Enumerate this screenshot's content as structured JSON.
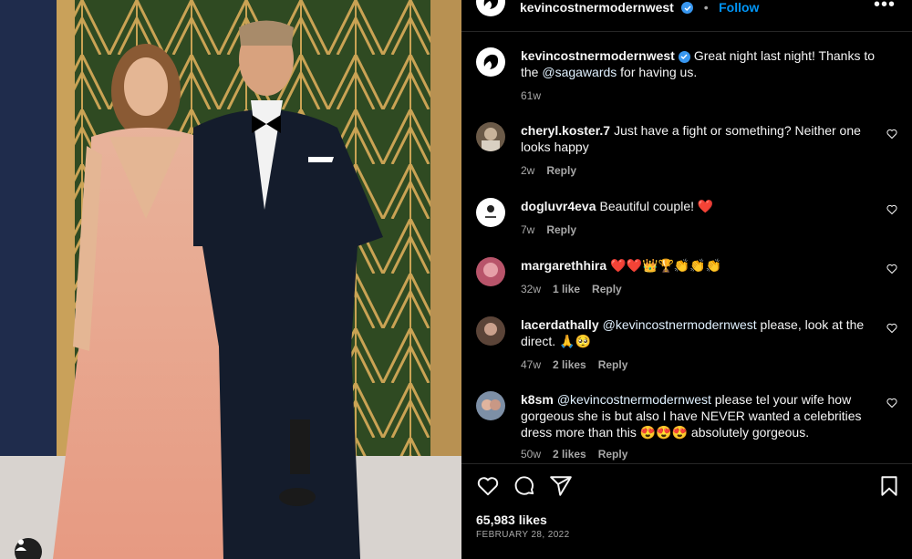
{
  "header": {
    "username": "kevincostnermodernwest",
    "separator": "•",
    "follow_label": "Follow",
    "more_label": "•••"
  },
  "caption": {
    "username": "kevincostnermodernwest",
    "text_before": "Great night last night! Thanks to the ",
    "mention": "@sagawards",
    "text_after": " for having us.",
    "time": "61w"
  },
  "comments": [
    {
      "username": "cheryl.koster.7",
      "text": "Just have a fight or something? Neither one looks happy",
      "time": "2w",
      "likes": "",
      "reply": "Reply"
    },
    {
      "username": "dogluvr4eva",
      "text": "Beautiful couple! ❤️",
      "time": "7w",
      "likes": "",
      "reply": "Reply"
    },
    {
      "username": "margarethhira",
      "text": "❤️❤️👑🏆👏👏👏",
      "time": "32w",
      "likes": "1 like",
      "reply": "Reply"
    },
    {
      "username": "lacerdathally",
      "mention": "@kevincostnermodernwest",
      "text": " please, look at the direct. 🙏🥺",
      "time": "47w",
      "likes": "2 likes",
      "reply": "Reply"
    },
    {
      "username": "k8sm",
      "mention": "@kevincostnermodernwest",
      "text": " please tel your wife how gorgeous she is but also I have NEVER wanted a celebrities dress more than this 😍😍😍 absolutely gorgeous.",
      "time": "50w",
      "likes": "2 likes",
      "reply": "Reply"
    }
  ],
  "likes_count": "65,983 likes",
  "post_date": "FEBRUARY 28, 2022",
  "colors": {
    "accent": "#0095f6",
    "verified": "#3897f0",
    "background": "#000000",
    "muted": "#a8a8a8"
  },
  "icons": [
    "verified-badge-icon",
    "more-options-icon",
    "heart-icon",
    "comment-icon",
    "share-icon",
    "bookmark-icon",
    "user-tag-icon"
  ]
}
